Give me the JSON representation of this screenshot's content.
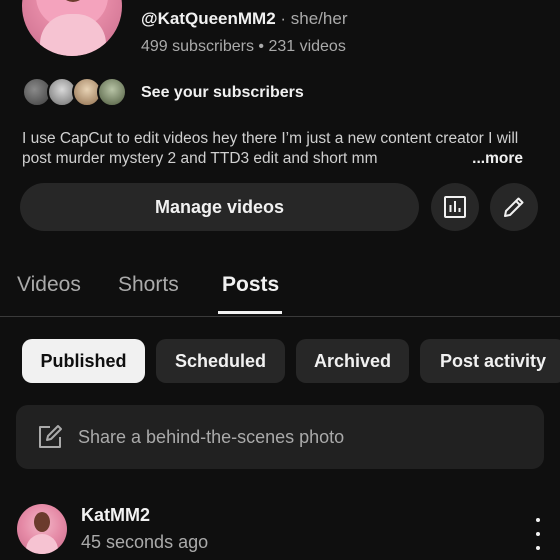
{
  "profile": {
    "handle": "@KatQueenMM2",
    "pronouns": "· she/her",
    "stats": "499 subscribers • 231 videos",
    "see_subscribers": "See your subscribers",
    "description": "I use CapCut to edit videos hey there I’m just a new content creator I will post murder mystery 2 and TTD3 edit and short mm",
    "more_label": "...more"
  },
  "actions": {
    "manage_videos": "Manage videos",
    "analytics_icon": "analytics-icon",
    "edit_icon": "edit-pencil-icon"
  },
  "tabs": [
    {
      "label": "Videos"
    },
    {
      "label": "Shorts"
    },
    {
      "label": "Posts",
      "active": true
    }
  ],
  "chips": [
    {
      "label": "Published",
      "active": true
    },
    {
      "label": "Scheduled"
    },
    {
      "label": "Archived"
    },
    {
      "label": "Post activity"
    }
  ],
  "composer": {
    "placeholder": "Share a behind-the-scenes photo",
    "icon": "edit-image-icon"
  },
  "post": {
    "author": "KatMM2",
    "time": "45 seconds ago",
    "menu_icon": "more-vert-icon"
  },
  "colors": {
    "background": "#0f0f0f",
    "surface": "#272727",
    "text": "#f1f1f1",
    "muted": "#aaaaaa",
    "accent_pink": "#e58aa6"
  }
}
